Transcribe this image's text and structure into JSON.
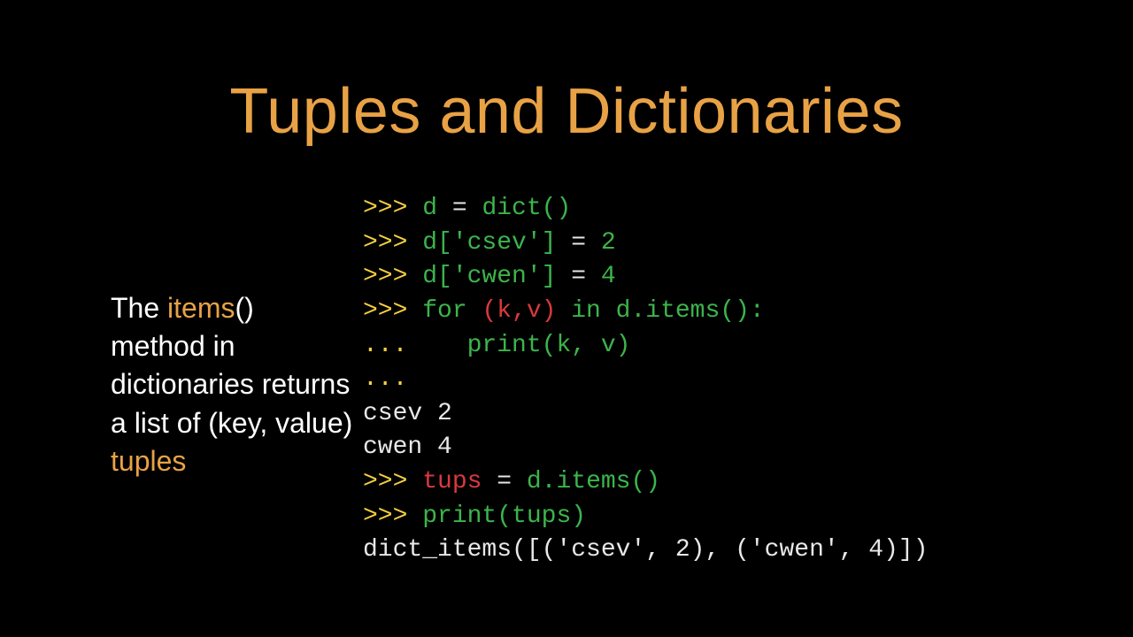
{
  "title": "Tuples and Dictionaries",
  "description": {
    "part1": "The ",
    "items": "items",
    "part2": "() method in dictionaries returns a list of (key, value) ",
    "tuples": "tuples"
  },
  "code": {
    "line1": {
      "prompt": ">>> ",
      "a": "d",
      "b": " = ",
      "c": "dict()"
    },
    "line2": {
      "prompt": ">>> ",
      "a": "d['csev']",
      "b": " = ",
      "c": "2"
    },
    "line3": {
      "prompt": ">>> ",
      "a": "d['cwen']",
      "b": " = ",
      "c": "4"
    },
    "line4": {
      "prompt": ">>> ",
      "a": "for ",
      "b": "(k,v)",
      "c": " in ",
      "d": "d.items():"
    },
    "line5": {
      "prompt": "...    ",
      "a": "print(k, v)"
    },
    "line6": {
      "prompt": "..."
    },
    "line7": {
      "a": "csev 2"
    },
    "line8": {
      "a": "cwen 4"
    },
    "line9": {
      "prompt": ">>> ",
      "a": "tups",
      "b": " = ",
      "c": "d.items()"
    },
    "line10": {
      "prompt": ">>> ",
      "a": "print(tups)"
    },
    "line11": {
      "a": "dict_items([('csev', 2), ('cwen', 4)])"
    }
  }
}
